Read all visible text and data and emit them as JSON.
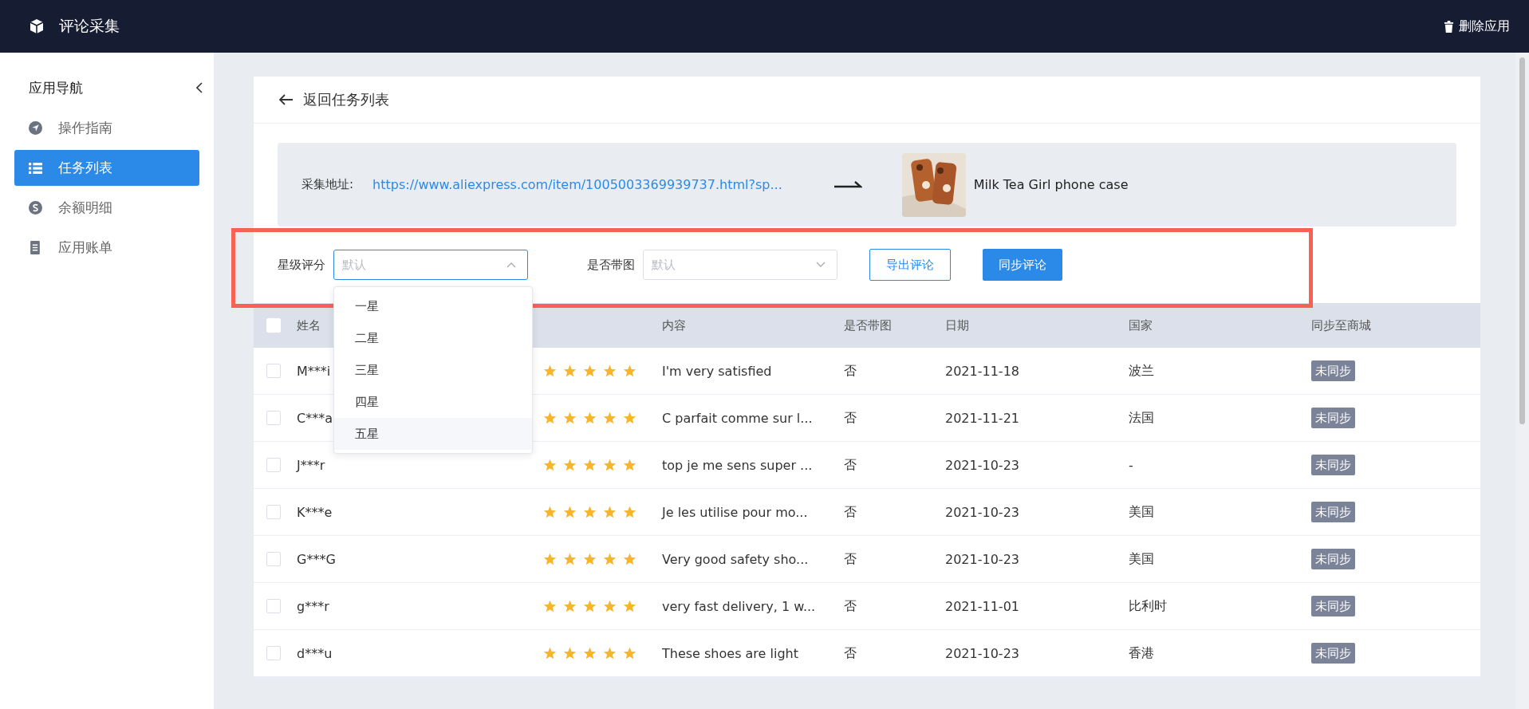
{
  "app_bar": {
    "title": "评论采集",
    "delete_button": "删除应用"
  },
  "sidebar": {
    "title": "应用导航",
    "items": [
      {
        "label": "操作指南",
        "selected": false
      },
      {
        "label": "任务列表",
        "selected": true
      },
      {
        "label": "余额明细",
        "selected": false
      },
      {
        "label": "应用账单",
        "selected": false
      }
    ]
  },
  "back_link": "返回任务列表",
  "source": {
    "label": "采集地址:",
    "url": "https://www.aliexpress.com/item/1005003369939737.html?sp...",
    "product_title": "Milk Tea Girl phone case"
  },
  "filters": {
    "rating": {
      "label": "星级评分",
      "placeholder": "默认",
      "expanded": true,
      "options": [
        {
          "label": "一星",
          "hovered": false
        },
        {
          "label": "二星",
          "hovered": false
        },
        {
          "label": "三星",
          "hovered": false
        },
        {
          "label": "四星",
          "hovered": false
        },
        {
          "label": "五星",
          "hovered": true
        }
      ]
    },
    "has_image": {
      "label": "是否带图",
      "placeholder": "默认",
      "expanded": false
    },
    "export_button": "导出评论",
    "sync_button": "同步评论"
  },
  "table": {
    "select_all_checked": false,
    "columns": [
      "姓名",
      "",
      "内容",
      "是否带图",
      "日期",
      "国家",
      "同步至商城"
    ],
    "rows": [
      {
        "checked": false,
        "name": "M***i",
        "stars": 5,
        "content": "I'm very satisfied",
        "has_image": "否",
        "date": "2021-11-18",
        "country": "波兰",
        "status": "未同步"
      },
      {
        "checked": false,
        "name": "C***a",
        "stars": 5,
        "content": "C parfait comme sur l...",
        "has_image": "否",
        "date": "2021-11-21",
        "country": "法国",
        "status": "未同步"
      },
      {
        "checked": false,
        "name": "J***r",
        "stars": 5,
        "content": "top je me sens super ...",
        "has_image": "否",
        "date": "2021-10-23",
        "country": "-",
        "status": "未同步"
      },
      {
        "checked": false,
        "name": "K***e",
        "stars": 5,
        "content": "Je les utilise pour mo...",
        "has_image": "否",
        "date": "2021-10-23",
        "country": "美国",
        "status": "未同步"
      },
      {
        "checked": false,
        "name": "G***G",
        "stars": 5,
        "content": "Very good safety sho...",
        "has_image": "否",
        "date": "2021-10-23",
        "country": "美国",
        "status": "未同步"
      },
      {
        "checked": false,
        "name": "g***r",
        "stars": 5,
        "content": "very fast delivery, 1 w...",
        "has_image": "否",
        "date": "2021-11-01",
        "country": "比利时",
        "status": "未同步"
      },
      {
        "checked": false,
        "name": "d***u",
        "stars": 5,
        "content": "These shoes are light",
        "has_image": "否",
        "date": "2021-10-23",
        "country": "香港",
        "status": "未同步"
      }
    ]
  }
}
